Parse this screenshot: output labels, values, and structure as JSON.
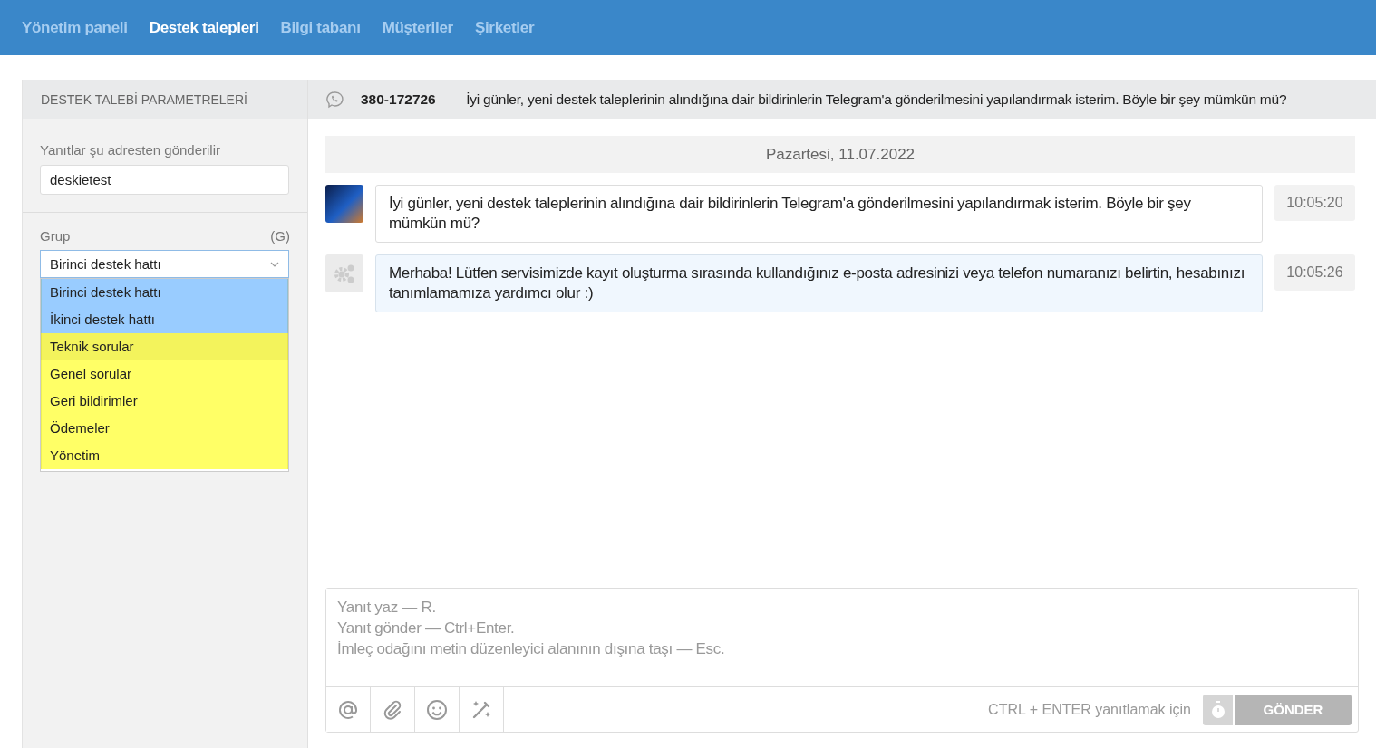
{
  "nav": [
    {
      "label": "Yönetim paneli",
      "selected": false
    },
    {
      "label": "Destek talepleri",
      "selected": true
    },
    {
      "label": "Bilgi tabanı",
      "selected": false
    },
    {
      "label": "Müşteriler",
      "selected": false
    },
    {
      "label": "Şirketler",
      "selected": false
    }
  ],
  "sidebar": {
    "title": "DESTEK TALEBİ PARAMETRELERİ",
    "reply_from": {
      "label": "Yanıtlar şu adresten gönderilir",
      "value": "deskietest"
    },
    "group": {
      "label": "Grup",
      "shortcut": "(G)",
      "value": "Birinci destek hattı",
      "expanded": true,
      "options": [
        {
          "label": "Birinci destek hattı",
          "color": "#99ccff",
          "hovered": false
        },
        {
          "label": "İkinci destek hattı",
          "color": "#99ccff",
          "hovered": false
        },
        {
          "label": "Teknik sorular",
          "color": "#f3f35c",
          "hovered": false
        },
        {
          "label": "Genel sorular",
          "color": "#ffff66",
          "hovered": false
        },
        {
          "label": "Geri bildirimler",
          "color": "#ffff66",
          "hovered": false
        },
        {
          "label": "Ödemeler",
          "color": "#ffff66",
          "hovered": false
        },
        {
          "label": "Yönetim",
          "color": "#ffff66",
          "hovered": false
        }
      ]
    }
  },
  "ticket": {
    "number": "380-172726",
    "separator": "—",
    "subject": "İyi günler, yeni destek taleplerinin alındığına dair bildirinlerin Telegram'a gönderilmesini yapılandırmak isterim. Böyle bir şey mümkün mü?"
  },
  "date": "Pazartesi, 11.07.2022",
  "messages": [
    {
      "kind": "customer",
      "text": "İyi günler, yeni destek taleplerinin alındığına dair bildirinlerin Telegram'a gönderilmesini yapılandırmak isterim. Böyle bir şey mümkün mü?",
      "time": "10:05:20"
    },
    {
      "kind": "agent",
      "text": "Merhaba! Lütfen servisimizde kayıt oluşturma sırasında kullandığınız e-posta adresinizi veya telefon numaranızı belirtin, hesabınızı tanımlamamıza yardımcı olur :)",
      "time": "10:05:26"
    }
  ],
  "editor": {
    "placeholder": "Yanıt yaz — R.\nYanıt gönder — Ctrl+Enter.\nİmleç odağını metin düzenleyici alanının dışına taşı — Esc.",
    "hint": "CTRL + ENTER yanıtlamak için",
    "send": {
      "label": "GÖNDER",
      "disabled": true
    }
  }
}
